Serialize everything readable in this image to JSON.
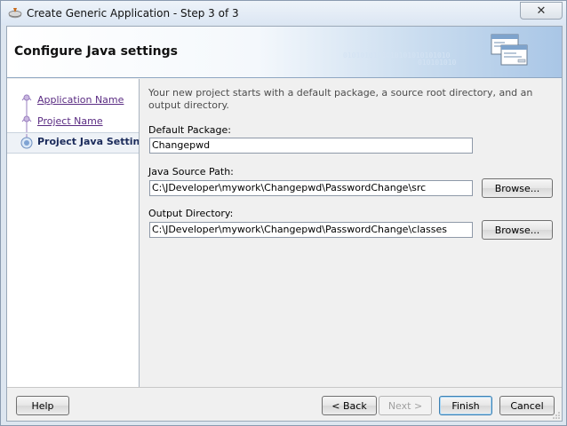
{
  "window": {
    "title": "Create Generic Application - Step 3 of 3",
    "close_glyph": "✕"
  },
  "header": {
    "title": "Configure Java settings",
    "binary_line1": "0101010101010101010101010",
    "binary_line2": "010101010"
  },
  "nav": {
    "items": [
      {
        "label": "Application Name",
        "state": "visited"
      },
      {
        "label": "Project Name",
        "state": "visited"
      },
      {
        "label": "Project Java Settings",
        "state": "current"
      }
    ],
    "scroll_left": "<",
    "scroll_right": ">"
  },
  "content": {
    "intro": "Your new project starts with a default package, a source root directory, and an output directory.",
    "default_package": {
      "label": "Default Package:",
      "value": "Changepwd"
    },
    "java_source_path": {
      "label": "Java Source Path:",
      "value": "C:\\JDeveloper\\mywork\\Changepwd\\PasswordChange\\src",
      "browse": "Browse..."
    },
    "output_directory": {
      "label": "Output Directory:",
      "value": "C:\\JDeveloper\\mywork\\Changepwd\\PasswordChange\\classes",
      "browse": "Browse..."
    }
  },
  "footer": {
    "help": "Help",
    "back": "< Back",
    "next": "Next >",
    "finish": "Finish",
    "cancel": "Cancel"
  },
  "colors": {
    "link": "#5a2b82",
    "current_step": "#1a2a5a",
    "header_gradient_end": "#a9c6e6"
  },
  "icons": [
    "app-icon",
    "close-icon",
    "wizard-windows-icon",
    "step-node-icon",
    "current-step-icon",
    "resize-grip-icon"
  ]
}
